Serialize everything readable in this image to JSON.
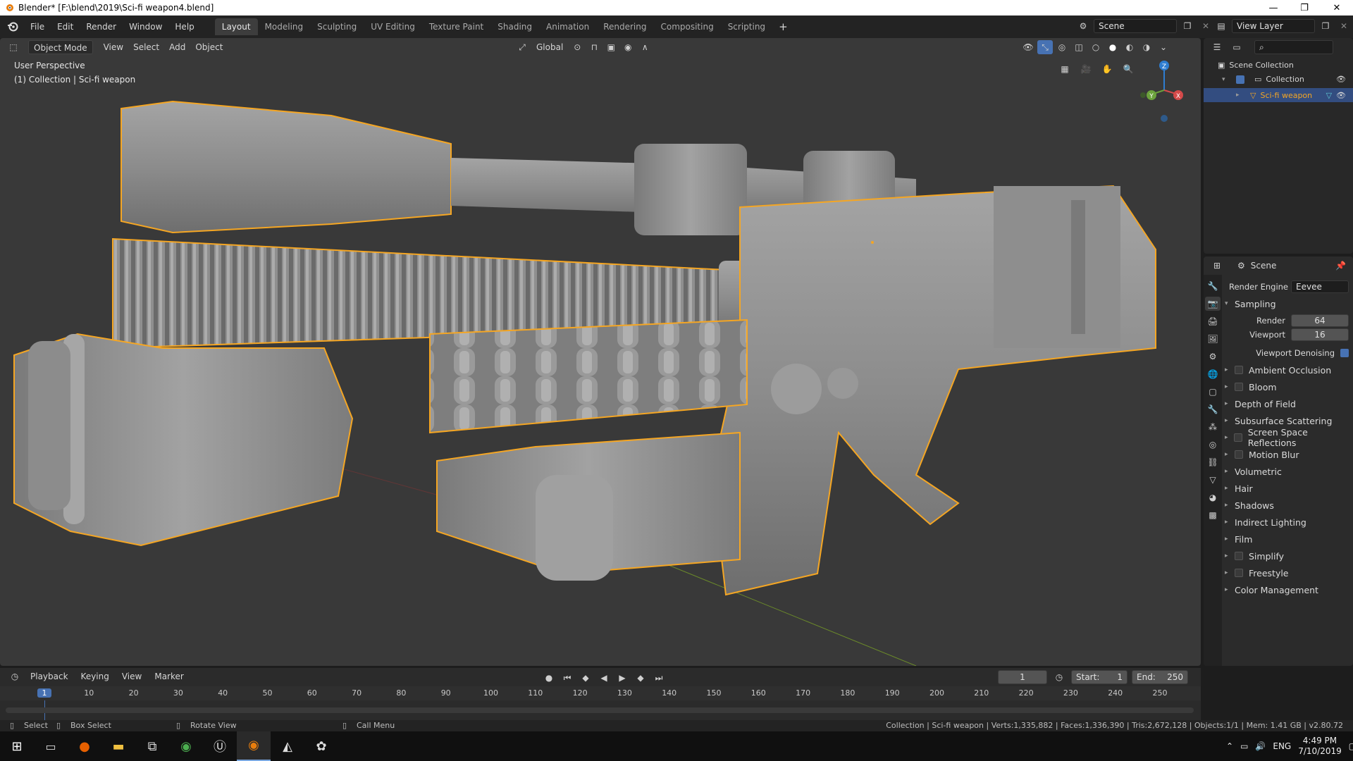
{
  "window": {
    "title": "Blender* [F:\\blend\\2019\\Sci-fi weapon4.blend]",
    "controls": [
      "—",
      "❐",
      "✕"
    ]
  },
  "menu": [
    "File",
    "Edit",
    "Render",
    "Window",
    "Help"
  ],
  "workspaces": [
    "Layout",
    "Modeling",
    "Sculpting",
    "UV Editing",
    "Texture Paint",
    "Shading",
    "Animation",
    "Rendering",
    "Compositing",
    "Scripting"
  ],
  "active_workspace": "Layout",
  "scene_field": "Scene",
  "view_layer_field": "View Layer",
  "viewport": {
    "mode": "Object Mode",
    "header_menus": [
      "View",
      "Select",
      "Add",
      "Object"
    ],
    "transform_orientation": "Global",
    "overlay_title": "User Perspective",
    "overlay_subtitle": "(1) Collection | Sci-fi weapon",
    "gizmo": {
      "z": "Z",
      "y": "Y",
      "x": "X"
    }
  },
  "outliner": {
    "root": "Scene Collection",
    "collection": "Collection",
    "object": "Sci-fi weapon"
  },
  "properties": {
    "header": "Scene",
    "render_engine_label": "Render Engine",
    "render_engine_value": "Eevee",
    "sampling_label": "Sampling",
    "render_label": "Render",
    "render_value": "64",
    "viewport_label": "Viewport",
    "viewport_value": "16",
    "viewport_denoising": "Viewport Denoising",
    "panels": [
      {
        "label": "Ambient Occlusion",
        "checkbox": true
      },
      {
        "label": "Bloom",
        "checkbox": true
      },
      {
        "label": "Depth of Field",
        "checkbox": false
      },
      {
        "label": "Subsurface Scattering",
        "checkbox": false
      },
      {
        "label": "Screen Space Reflections",
        "checkbox": true
      },
      {
        "label": "Motion Blur",
        "checkbox": true
      },
      {
        "label": "Volumetric",
        "checkbox": false
      },
      {
        "label": "Hair",
        "checkbox": false
      },
      {
        "label": "Shadows",
        "checkbox": false
      },
      {
        "label": "Indirect Lighting",
        "checkbox": false
      },
      {
        "label": "Film",
        "checkbox": false
      },
      {
        "label": "Simplify",
        "checkbox": true
      },
      {
        "label": "Freestyle",
        "checkbox": true
      },
      {
        "label": "Color Management",
        "checkbox": false
      }
    ]
  },
  "timeline": {
    "menus": [
      "Playback",
      "Keying",
      "View",
      "Marker"
    ],
    "current_frame": "1",
    "start_label": "Start:",
    "start_value": "1",
    "end_label": "End:",
    "end_value": "250",
    "ruler": [
      "1",
      "10",
      "20",
      "30",
      "40",
      "50",
      "60",
      "70",
      "80",
      "90",
      "100",
      "110",
      "120",
      "130",
      "140",
      "150",
      "160",
      "170",
      "180",
      "190",
      "200",
      "210",
      "220",
      "230",
      "240",
      "250"
    ]
  },
  "statusbar": {
    "select": "Select",
    "box_select": "Box Select",
    "rotate_view": "Rotate View",
    "call_menu": "Call Menu",
    "stats": "Collection | Sci-fi weapon | Verts:1,335,882 | Faces:1,336,390 | Tris:2,672,128 | Objects:1/1 | Mem: 1.41 GB | v2.80.72"
  },
  "taskbar": {
    "lang": "ENG",
    "time": "4:49 PM",
    "date": "7/10/2019"
  },
  "colors": {
    "accent": "#4772b3",
    "selection_outline": "#f5a623",
    "viewport_bg": "#393939"
  }
}
